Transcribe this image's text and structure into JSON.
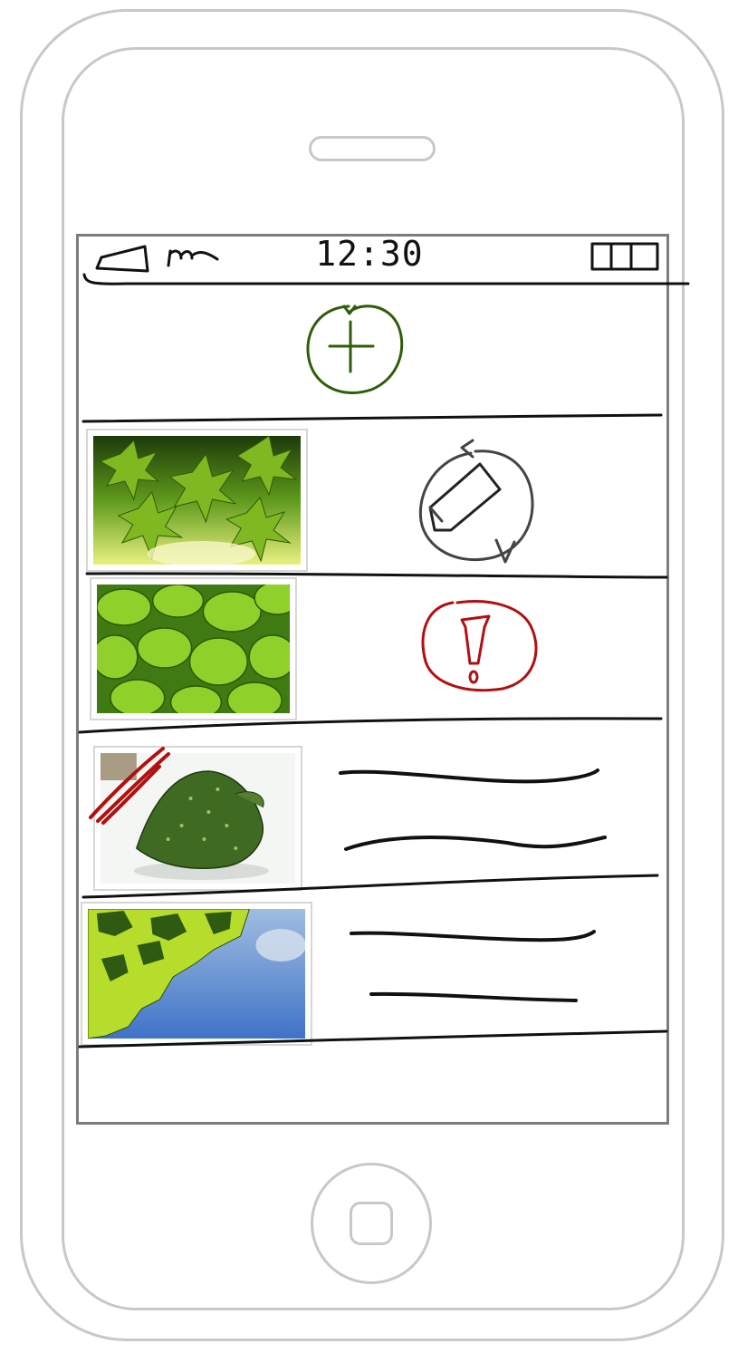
{
  "status_bar": {
    "time": "12:30",
    "signal_icon": "signal-icon",
    "battery_icon": "battery-icon"
  },
  "add_row": {
    "icon": "add-icon",
    "color": "#2f5e0a"
  },
  "rows": [
    {
      "thumbnail": "maple-leaves-photo",
      "action_icon": "edit-sync-icon",
      "icon_color": "#444444"
    },
    {
      "thumbnail": "green-leaves-photo",
      "action_icon": "alert-icon",
      "icon_color": "#b01010"
    },
    {
      "thumbnail": "single-leaf-photo",
      "action_icon": "text-placeholder-lines",
      "thumbnail_crossed_out": true,
      "cross_color": "#b01010"
    },
    {
      "thumbnail": "leaves-sky-photo",
      "action_icon": "text-placeholder-lines"
    }
  ],
  "colors": {
    "frame": "#c8c8c8",
    "screen_border": "#7d7d7d",
    "sketch_ink": "#111111"
  }
}
